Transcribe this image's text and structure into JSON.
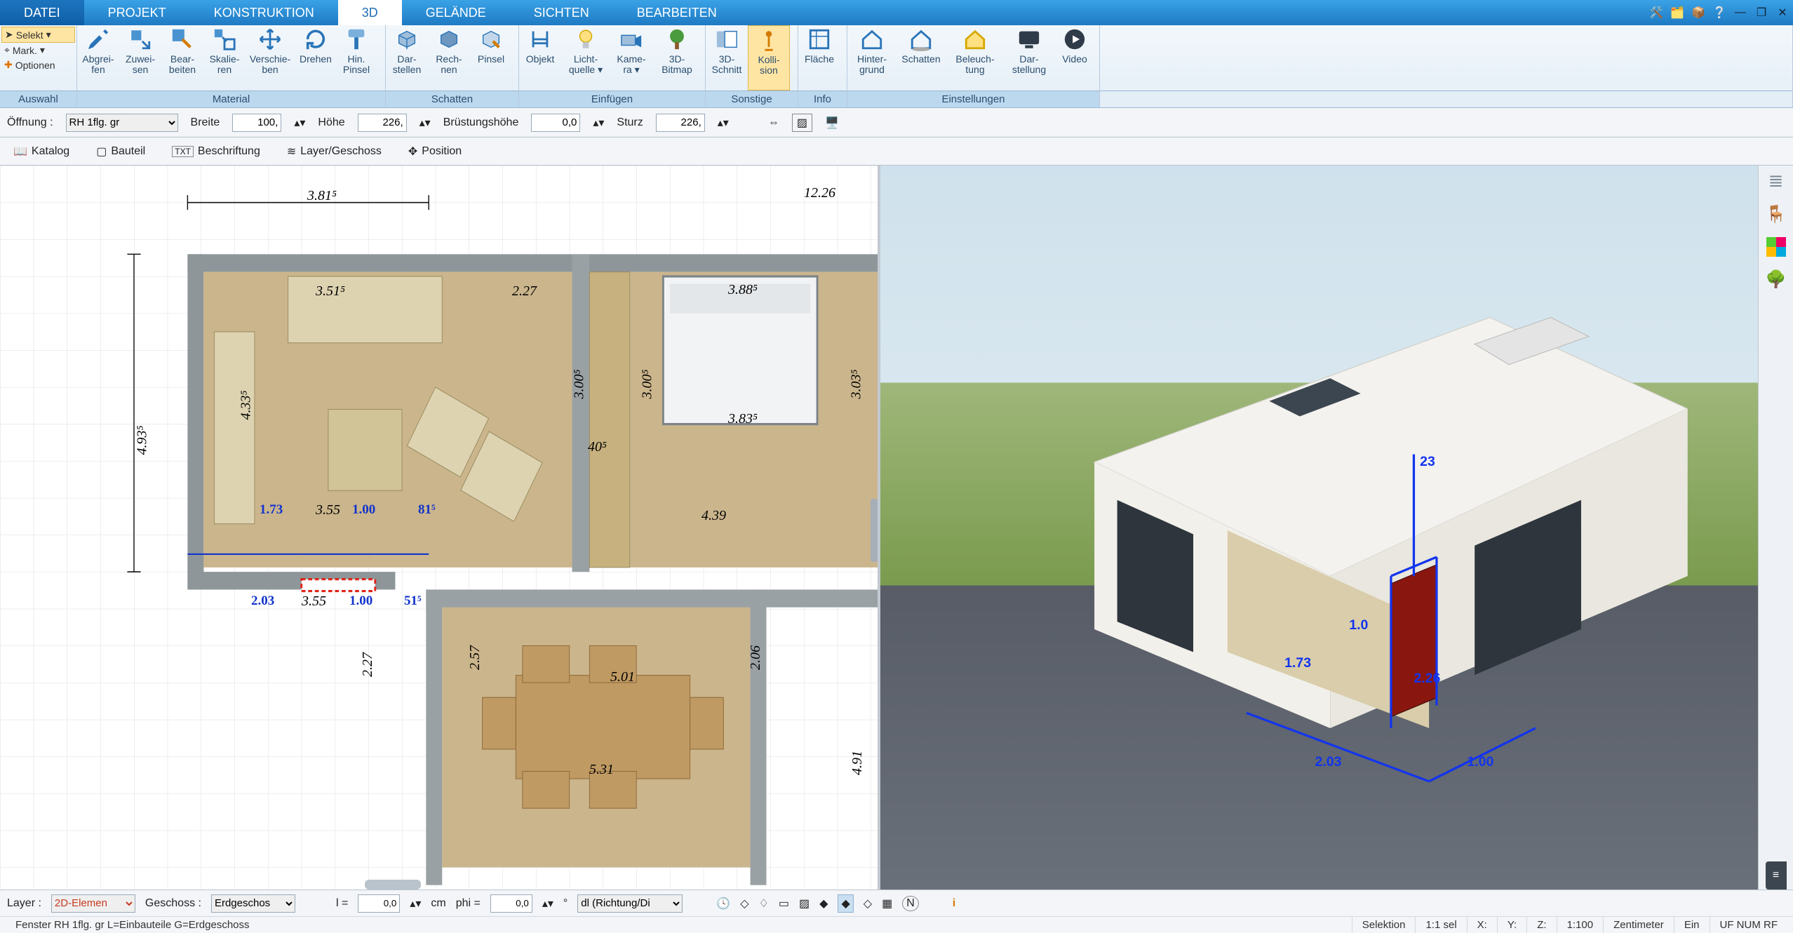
{
  "menu": {
    "datei": "DATEI",
    "tabs": [
      "PROJEKT",
      "KONSTRUKTION",
      "3D",
      "GELÄNDE",
      "SICHTEN",
      "BEARBEITEN"
    ],
    "active_index": 2
  },
  "selection_group": {
    "selekt": "Selekt",
    "mark": "Mark.",
    "optionen": "Optionen",
    "caption": "Auswahl"
  },
  "ribbon": [
    {
      "caption": "Material",
      "items": [
        {
          "name": "abgreifen",
          "l1": "Abgrei-",
          "l2": "fen"
        },
        {
          "name": "zuweisen",
          "l1": "Zuwei-",
          "l2": "sen"
        },
        {
          "name": "bearbeiten",
          "l1": "Bear-",
          "l2": "beiten"
        },
        {
          "name": "skalieren",
          "l1": "Skalie-",
          "l2": "ren"
        },
        {
          "name": "verschieben",
          "l1": "Verschie-",
          "l2": "ben"
        },
        {
          "name": "drehen",
          "l1": "Drehen",
          "l2": ""
        },
        {
          "name": "hin-pinsel",
          "l1": "Hin.",
          "l2": "Pinsel"
        }
      ]
    },
    {
      "caption": "Schatten",
      "items": [
        {
          "name": "darstellen",
          "l1": "Dar-",
          "l2": "stellen"
        },
        {
          "name": "rechnen",
          "l1": "Rech-",
          "l2": "nen"
        },
        {
          "name": "pinsel",
          "l1": "Pinsel",
          "l2": ""
        }
      ]
    },
    {
      "caption": "Einfügen",
      "items": [
        {
          "name": "objekt",
          "l1": "Objekt",
          "l2": ""
        },
        {
          "name": "lichtquelle",
          "l1": "Licht-",
          "l2": "quelle ▾"
        },
        {
          "name": "kamera",
          "l1": "Kame-",
          "l2": "ra ▾"
        },
        {
          "name": "3d-bitmap",
          "l1": "3D-",
          "l2": "Bitmap"
        }
      ]
    },
    {
      "caption": "Sonstige",
      "items": [
        {
          "name": "3d-schnitt",
          "l1": "3D-",
          "l2": "Schnitt"
        },
        {
          "name": "kollision",
          "l1": "Kolli-",
          "l2": "sion",
          "active": true
        }
      ]
    },
    {
      "caption": "Info",
      "items": [
        {
          "name": "flaeche",
          "l1": "Fläche",
          "l2": ""
        }
      ]
    },
    {
      "caption": "Einstellungen",
      "items": [
        {
          "name": "hintergrund",
          "l1": "Hinter-",
          "l2": "grund"
        },
        {
          "name": "schatten",
          "l1": "Schatten",
          "l2": ""
        },
        {
          "name": "beleuchtung",
          "l1": "Beleuch-",
          "l2": "tung"
        },
        {
          "name": "darstellung",
          "l1": "Dar-",
          "l2": "stellung"
        },
        {
          "name": "video",
          "l1": "Video",
          "l2": ""
        }
      ]
    }
  ],
  "prop_bar": {
    "label_oeffnung": "Öffnung :",
    "oeffnung_value": "RH 1flg. gr",
    "breite_label": "Breite",
    "breite_value": "100,",
    "hoehe_label": "Höhe",
    "hoehe_value": "226,",
    "bruest_label": "Brüstungshöhe",
    "bruest_value": "0,0",
    "sturz_label": "Sturz",
    "sturz_value": "226,"
  },
  "cat_bar": {
    "katalog": "Katalog",
    "bauteil": "Bauteil",
    "beschriftung": "Beschriftung",
    "layer": "Layer/Geschoss",
    "position": "Position"
  },
  "view2d_dims": {
    "top_left": "3.81⁵",
    "top_right": "12.26",
    "left_v": "4.93⁵",
    "living_w": "3.51⁵",
    "living_w2": "2.27",
    "bed_w": "3.88⁵",
    "bed_w2": "3.83⁵",
    "sofa_h": "4.33⁵",
    "living_h": "3.00⁵",
    "pass_h": "3.00⁵",
    "bed_h": "3.03⁵",
    "pass_w": "40⁵",
    "b1": "1.73",
    "b2": "3.55",
    "b3": "1.00",
    "b4": "81⁵",
    "mid_right": "4.39",
    "c1": "2.03",
    "c2": "3.55",
    "c3": "1.00",
    "c4": "51⁵",
    "din_h_l": "2.27",
    "din_h": "2.57",
    "din_h_r": "2.06",
    "din_w": "5.01",
    "btm": "5.31",
    "kit_h": "4.91"
  },
  "view3d_dims": {
    "a": "2.03",
    "b": "1.00",
    "c": "1.73",
    "d": "23",
    "e": "2.26",
    "f": "1.0"
  },
  "bottom_bar": {
    "layer_label": "Layer :",
    "layer_value": "2D-Elemen",
    "geschoss_label": "Geschoss :",
    "geschoss_value": "Erdgeschos",
    "l_label": "l =",
    "l_value": "0,0",
    "cm": "cm",
    "phi_label": "phi =",
    "phi_value": "0,0",
    "deg": "°",
    "mode": "dl (Richtung/Di"
  },
  "status": {
    "left": "Fenster RH 1flg. gr L=Einbauteile G=Erdgeschoss",
    "selektion": "Selektion",
    "sel": "1:1 sel",
    "x": "X:",
    "y": "Y:",
    "z": "Z:",
    "scale": "1:100",
    "unit": "Zentimeter",
    "ein": "Ein",
    "flags": "UF NUM RF"
  }
}
